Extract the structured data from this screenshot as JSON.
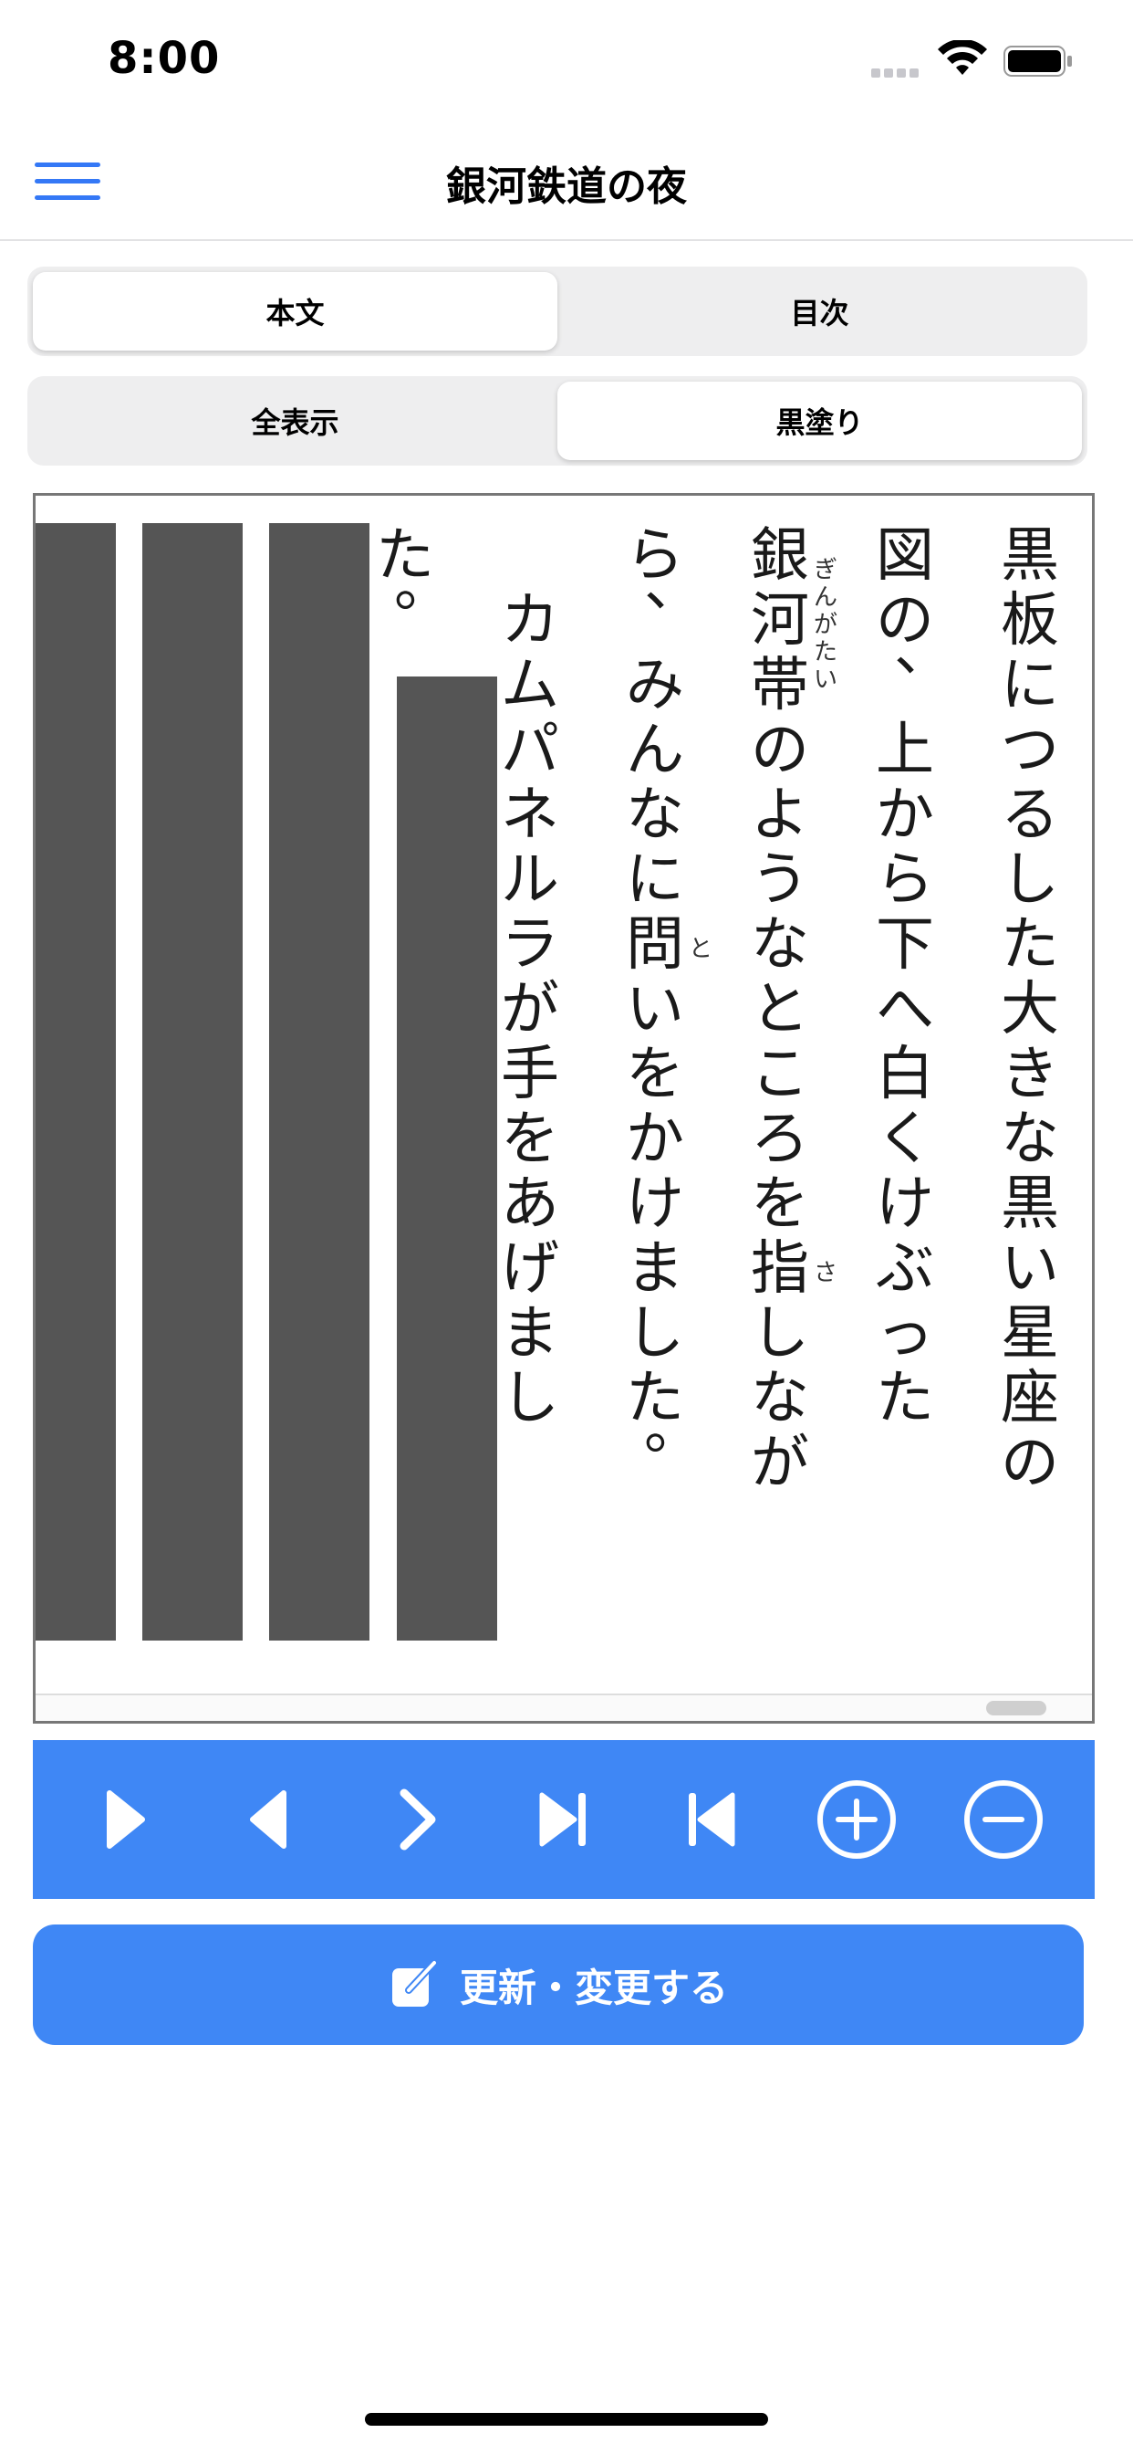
{
  "status_bar": {
    "time": "8:00"
  },
  "nav": {
    "title": "銀河鉄道の夜"
  },
  "main_tabs": [
    {
      "label": "本文",
      "active": true
    },
    {
      "label": "目次",
      "active": false
    }
  ],
  "mode_tabs": [
    {
      "label": "全表示",
      "active": false
    },
    {
      "label": "黒塗り",
      "active": true
    }
  ],
  "reader": {
    "columns": [
      {
        "text": "黒板につるした大きな黒い星座の",
        "ruby": []
      },
      {
        "text": "図の、上から下へ白くけぶった",
        "ruby": []
      },
      {
        "text": "銀河帯のようなところを指しなが",
        "ruby": [
          {
            "over": "銀河帯",
            "text": "ぎんがたい"
          },
          {
            "over": "指",
            "text": "さ"
          }
        ]
      },
      {
        "text": "ら、みんなに問いをかけました。",
        "ruby": [
          {
            "over": "問",
            "text": "と"
          }
        ]
      },
      {
        "text": "　カムパネルラが手をあげまし",
        "ruby": []
      },
      {
        "text": "た。",
        "ruby": []
      }
    ],
    "masked_column_count": 4
  },
  "toolbar": {
    "buttons": [
      {
        "icon": "play-icon",
        "name": "play-button"
      },
      {
        "icon": "previous-icon",
        "name": "previous-button"
      },
      {
        "icon": "next-icon",
        "name": "next-button"
      },
      {
        "icon": "skip-to-end-icon",
        "name": "skip-to-end-button"
      },
      {
        "icon": "skip-to-start-icon",
        "name": "skip-to-start-button"
      },
      {
        "icon": "zoom-in-icon",
        "name": "zoom-in-button"
      },
      {
        "icon": "zoom-out-icon",
        "name": "zoom-out-button"
      }
    ]
  },
  "update_button": {
    "label": "更新・変更する",
    "icon": "edit-icon"
  },
  "colors": {
    "accent": "#3f87f5",
    "mask": "#555555",
    "segment_bg": "#eeeeef"
  }
}
